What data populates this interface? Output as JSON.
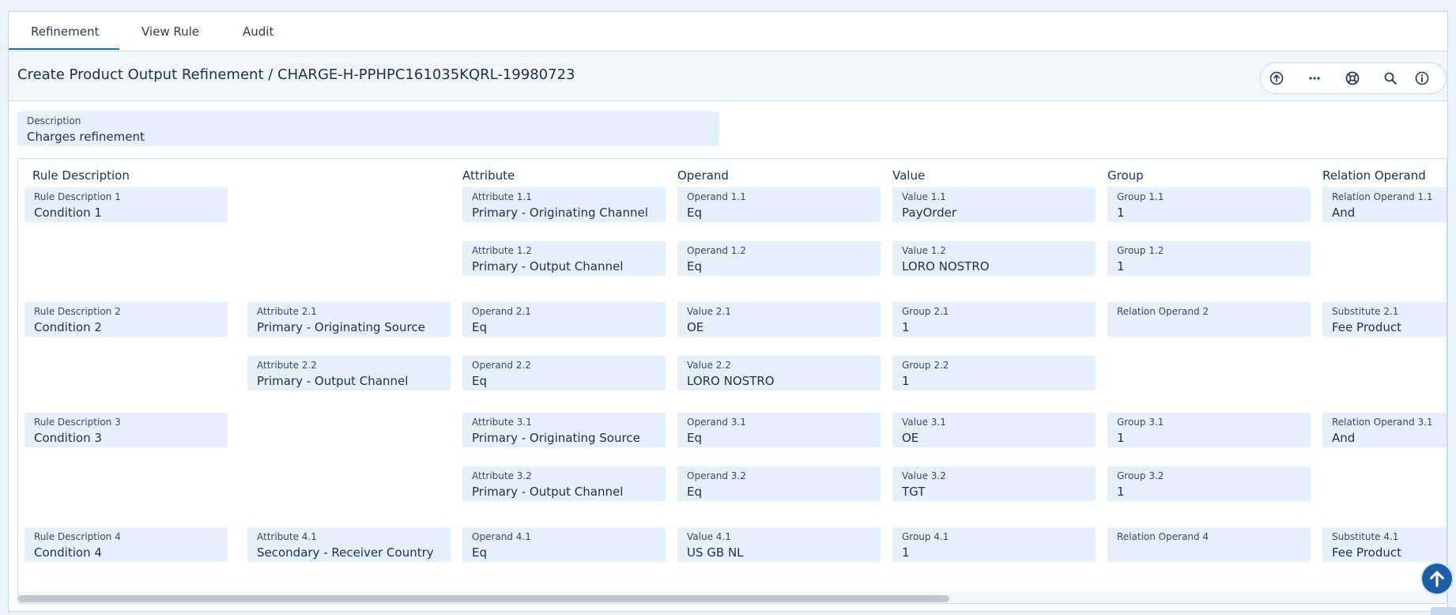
{
  "tabs": [
    {
      "label": "Refinement",
      "active": true
    },
    {
      "label": "View Rule",
      "active": false
    },
    {
      "label": "Audit",
      "active": false
    }
  ],
  "page_title": "Create Product Output Refinement / CHARGE-H-PPHPC161035KQRL-19980723",
  "toolbar_icons": [
    "upload-icon",
    "more-icon",
    "help-lifebuoy-icon",
    "search-icon",
    "info-icon"
  ],
  "description": {
    "label": "Description",
    "value": "Charges refinement"
  },
  "columns": [
    "Rule Description",
    "Attribute",
    "Operand",
    "Value",
    "Group",
    "Relation Operand"
  ],
  "rules": [
    {
      "id": "rule-1",
      "description": {
        "label": "Rule Description 1",
        "value": "Condition 1"
      },
      "rows": [
        [
          {
            "label": "Attribute 1.1",
            "value": "Primary - Originating Channel"
          },
          {
            "label": "Operand 1.1",
            "value": "Eq"
          },
          {
            "label": "Value 1.1",
            "value": "PayOrder"
          },
          {
            "label": "Group 1.1",
            "value": "1"
          },
          {
            "label": "Relation Operand 1.1",
            "value": "And"
          }
        ],
        [
          {
            "label": "Attribute 1.2",
            "value": "Primary - Output Channel"
          },
          {
            "label": "Operand 1.2",
            "value": "Eq"
          },
          {
            "label": "Value 1.2",
            "value": "LORO NOSTRO"
          },
          {
            "label": "Group 1.2",
            "value": "1"
          }
        ]
      ]
    },
    {
      "id": "rule-2",
      "description": {
        "label": "Rule Description 2",
        "value": "Condition 2"
      },
      "rows": [
        [
          {
            "label": "Attribute 2.1",
            "value": "Primary - Originating Source"
          },
          {
            "label": "Operand 2.1",
            "value": "Eq"
          },
          {
            "label": "Value 2.1",
            "value": "OE"
          },
          {
            "label": "Group 2.1",
            "value": "1"
          },
          {
            "label": "Relation Operand 2",
            "value": ""
          },
          {
            "label": "Substitute 2.1",
            "value": "Fee Product"
          }
        ],
        [
          {
            "label": "Attribute 2.2",
            "value": "Primary - Output Channel"
          },
          {
            "label": "Operand 2.2",
            "value": "Eq"
          },
          {
            "label": "Value 2.2",
            "value": "LORO NOSTRO"
          },
          {
            "label": "Group 2.2",
            "value": "1"
          }
        ]
      ]
    },
    {
      "id": "rule-3",
      "description": {
        "label": "Rule Description 3",
        "value": "Condition 3"
      },
      "rows": [
        [
          {
            "label": "Attribute 3.1",
            "value": "Primary - Originating Source"
          },
          {
            "label": "Operand 3.1",
            "value": "Eq"
          },
          {
            "label": "Value 3.1",
            "value": "OE"
          },
          {
            "label": "Group 3.1",
            "value": "1"
          },
          {
            "label": "Relation Operand 3.1",
            "value": "And"
          }
        ],
        [
          {
            "label": "Attribute 3.2",
            "value": "Primary - Output Channel"
          },
          {
            "label": "Operand 3.2",
            "value": "Eq"
          },
          {
            "label": "Value 3.2",
            "value": "TGT"
          },
          {
            "label": "Group 3.2",
            "value": "1"
          }
        ]
      ]
    },
    {
      "id": "rule-4",
      "description": {
        "label": "Rule Description 4",
        "value": "Condition 4"
      },
      "rows": [
        [
          {
            "label": "Attribute 4.1",
            "value": "Secondary - Receiver Country"
          },
          {
            "label": "Operand 4.1",
            "value": "Eq"
          },
          {
            "label": "Value 4.1",
            "value": "US GB NL"
          },
          {
            "label": "Group 4.1",
            "value": "1"
          },
          {
            "label": "Relation Operand 4",
            "value": ""
          },
          {
            "label": "Substitute 4.1",
            "value": "Fee Product"
          }
        ]
      ]
    }
  ]
}
